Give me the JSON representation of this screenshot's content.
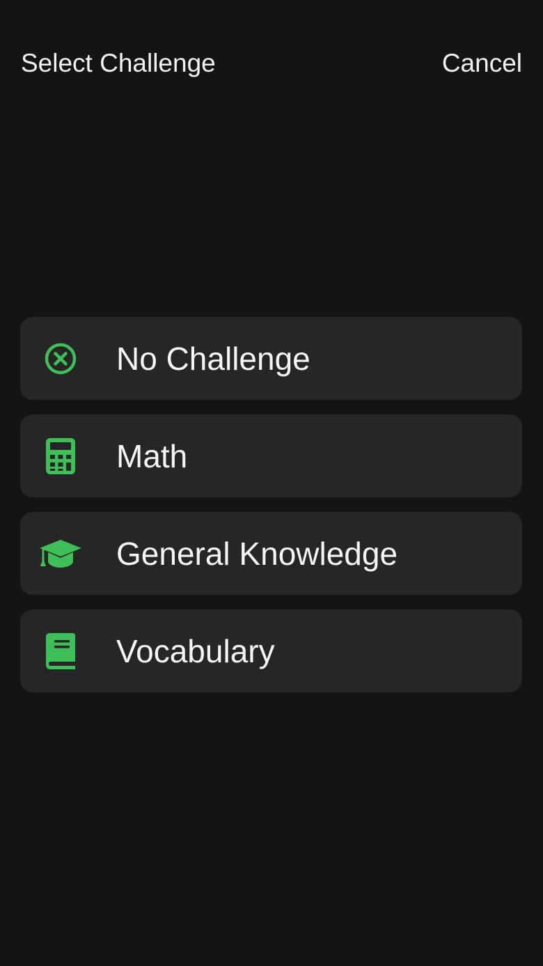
{
  "header": {
    "title": "Select Challenge",
    "cancel_label": "Cancel"
  },
  "accent_color": "#3fbf57",
  "options": [
    {
      "label": "No Challenge",
      "icon": "x-circle-icon"
    },
    {
      "label": "Math",
      "icon": "calculator-icon"
    },
    {
      "label": "General Knowledge",
      "icon": "graduation-cap-icon"
    },
    {
      "label": "Vocabulary",
      "icon": "book-icon"
    }
  ]
}
